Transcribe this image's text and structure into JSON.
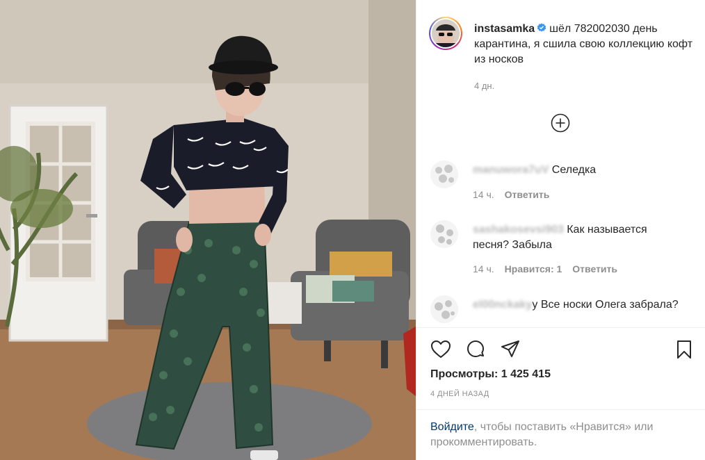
{
  "post": {
    "username": "instasamka",
    "caption": "шёл 782002030 день карантина, я сшила свою коллекцию кофт из носков",
    "time_ago": "4 дн.",
    "verified_icon": "verified-badge-icon",
    "load_more_icon": "plus-circle-icon"
  },
  "comments": [
    {
      "user": "manuwora7uV",
      "text": " Селедка",
      "time": "14 ч.",
      "likes": "",
      "reply": "Ответить"
    },
    {
      "user": "sashakosevsi903",
      "text": " Как называется песня? Забыла",
      "time": "14 ч.",
      "likes": "Нравится: 1",
      "reply": "Ответить"
    },
    {
      "user": "el00nckaky",
      "text": "y Все носки Олега забрала?",
      "time": "",
      "likes": "",
      "reply": ""
    }
  ],
  "actions": {
    "like_icon": "heart-icon",
    "comment_icon": "comment-icon",
    "share_icon": "paper-plane-icon",
    "save_icon": "bookmark-icon"
  },
  "stats": {
    "views": "Просмотры: 1 425 415",
    "date": "4 дней назад"
  },
  "login_prompt": {
    "link": "Войдите",
    "rest": ", чтобы поставить «Нравится» или прокомментировать."
  },
  "colors": {
    "link": "#00376b",
    "verified": "#3897f0",
    "muted": "#8e8e8e",
    "text": "#262626"
  }
}
